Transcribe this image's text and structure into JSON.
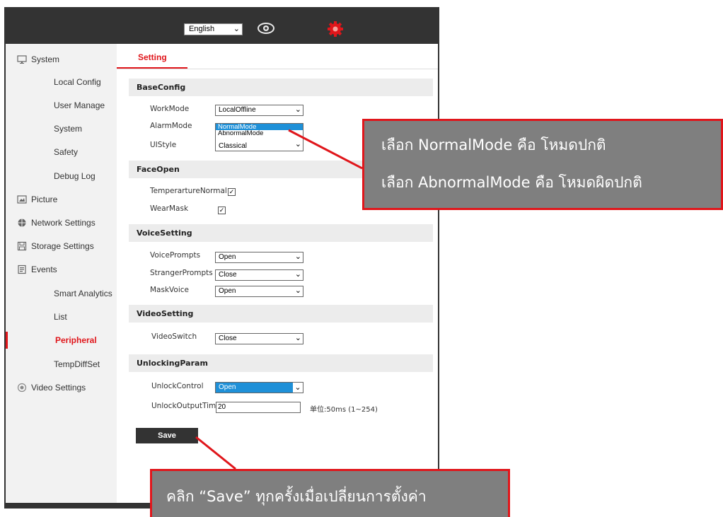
{
  "topbar": {
    "language": "English",
    "icons": [
      "eye-icon",
      "gear-icon"
    ],
    "gear_color": "#e0161b"
  },
  "sidebar": {
    "items": [
      {
        "label": "System",
        "icon": "monitor-icon",
        "level": 0
      },
      {
        "label": "Local Config",
        "level": 1
      },
      {
        "label": "User Manage",
        "level": 1
      },
      {
        "label": "System",
        "level": 1
      },
      {
        "label": "Safety",
        "level": 1
      },
      {
        "label": "Debug Log",
        "level": 1
      },
      {
        "label": "Picture",
        "icon": "picture-icon",
        "level": 0
      },
      {
        "label": "Network Settings",
        "icon": "globe-icon",
        "level": 0
      },
      {
        "label": "Storage Settings",
        "icon": "floppy-icon",
        "level": 0
      },
      {
        "label": "Events",
        "icon": "events-icon",
        "level": 0
      },
      {
        "label": "Smart Analytics",
        "level": 1
      },
      {
        "label": "List",
        "level": 1
      },
      {
        "label": "Peripheral",
        "level": 1,
        "active": true
      },
      {
        "label": "TempDiffSet",
        "level": 1
      },
      {
        "label": "Video Settings",
        "icon": "video-icon",
        "level": 0
      }
    ]
  },
  "main": {
    "tab": "Setting",
    "sections": {
      "baseconfig": "BaseConfig",
      "faceopen": "FaceOpen",
      "voicesetting": "VoiceSetting",
      "videosetting": "VideoSetting",
      "unlockingparam": "UnlockingParam"
    },
    "fields": {
      "workmode": {
        "label": "WorkMode",
        "value": "LocalOffline"
      },
      "alarmmode": {
        "label": "AlarmMode",
        "options": [
          "NormalMode",
          "AbnormalMode"
        ]
      },
      "uistyle": {
        "label": "UIStyle",
        "value": "Classical"
      },
      "temperature": {
        "label": "TemperartureNormal",
        "checked": "✓"
      },
      "wearmask": {
        "label": "WearMask",
        "checked": "✓"
      },
      "voiceprompts": {
        "label": "VoicePrompts",
        "value": "Open"
      },
      "strangerprompts": {
        "label": "StrangerPrompts",
        "value": "Close"
      },
      "maskvoice": {
        "label": "MaskVoice",
        "value": "Open"
      },
      "videoswitch": {
        "label": "VideoSwitch",
        "value": "Close"
      },
      "unlockcontrol": {
        "label": "UnlockControl",
        "value": "Open"
      },
      "unlockoutputtime": {
        "label": "UnlockOutputTime",
        "value": "20",
        "unit": "单位:50ms (1~254)"
      }
    },
    "save_label": "Save"
  },
  "callouts": {
    "mode_line1": "เลือก NormalMode คือ โหมดปกติ",
    "mode_line2": "เลือก AbnormalMode คือ โหมดผิดปกติ",
    "save_note": "คลิก “Save” ทุกครั้งเมื่อเปลี่ยนการตั้งค่า"
  }
}
